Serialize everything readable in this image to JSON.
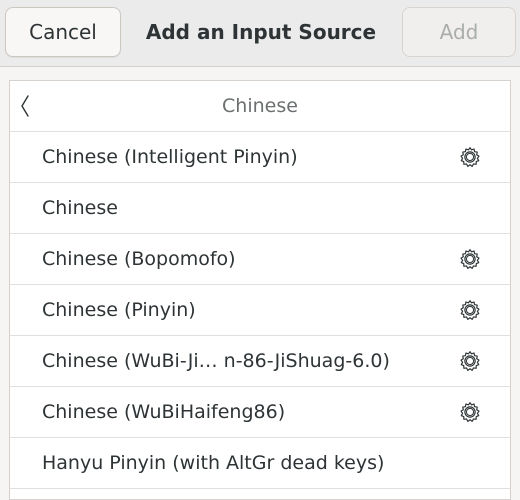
{
  "dialog": {
    "title": "Add an Input Source",
    "cancel_label": "Cancel",
    "add_label": "Add"
  },
  "list": {
    "header": "Chinese",
    "items": [
      {
        "label": "Chinese (Intelligent Pinyin)",
        "has_settings": true
      },
      {
        "label": "Chinese",
        "has_settings": false
      },
      {
        "label": "Chinese (Bopomofo)",
        "has_settings": true
      },
      {
        "label": "Chinese (Pinyin)",
        "has_settings": true
      },
      {
        "label": "Chinese (WuBi-Ji… n-86-JiShuag-6.0)",
        "has_settings": true
      },
      {
        "label": "Chinese (WuBiHaifeng86)",
        "has_settings": true
      },
      {
        "label": "Hanyu Pinyin (with AltGr dead keys)",
        "has_settings": false
      }
    ]
  },
  "icons": {
    "back": "chevron-left-icon",
    "settings": "gear-icon"
  },
  "colors": {
    "headerbar_bg": "#ebebeb",
    "list_bg": "#ffffff",
    "text": "#2e3436",
    "disabled_text": "#a9adab",
    "header_text": "#6b6f70"
  }
}
